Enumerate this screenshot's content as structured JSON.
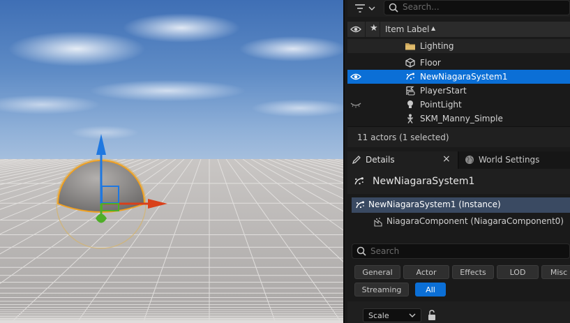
{
  "outliner": {
    "search_placeholder": "Search...",
    "column_item_label": "Item Label",
    "sort_indicator": "▲",
    "items": [
      {
        "label": "Lighting",
        "icon": "folder-icon"
      },
      {
        "label": "Floor",
        "icon": "static-mesh-icon"
      },
      {
        "label": "NewNiagaraSystem1",
        "icon": "niagara-system-icon"
      },
      {
        "label": "PlayerStart",
        "icon": "player-start-icon"
      },
      {
        "label": "PointLight",
        "icon": "point-light-icon"
      },
      {
        "label": "SKM_Manny_Simple",
        "icon": "skeletal-mesh-icon"
      }
    ],
    "status": "11 actors (1 selected)"
  },
  "tabs": {
    "details": "Details",
    "close": "×",
    "world_settings": "World Settings"
  },
  "details": {
    "actor_name": "NewNiagaraSystem1",
    "components": [
      {
        "label": "NewNiagaraSystem1 (Instance)"
      },
      {
        "label": "NiagaraComponent (NiagaraComponent0)"
      }
    ],
    "search_placeholder": "Search",
    "filters_row1": [
      "General",
      "Actor",
      "Effects",
      "LOD",
      "Misc"
    ],
    "filters_row2": [
      "Streaming",
      "All"
    ],
    "active_filter": "All",
    "scale_dropdown": "Scale"
  },
  "colors": {
    "selection": "#0b6fd6",
    "gizmo_x": "#d9401a",
    "gizmo_y": "#4fae28",
    "gizmo_z": "#1f78e0",
    "selection_outline": "#f0a020"
  }
}
